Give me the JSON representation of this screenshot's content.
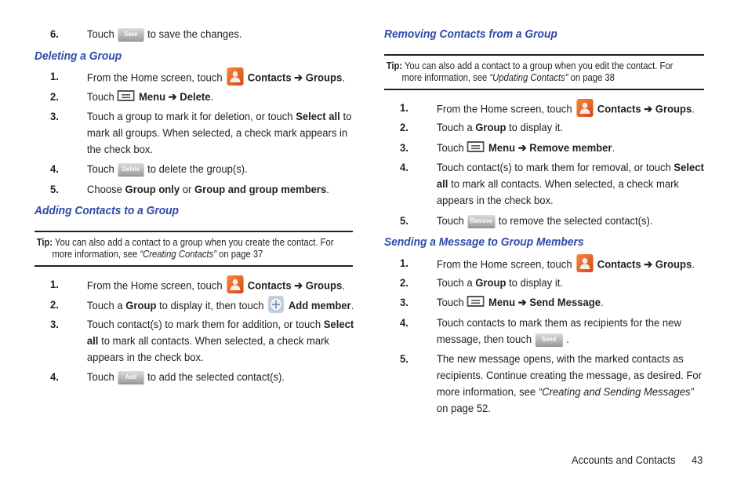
{
  "left": {
    "step6": {
      "num": "6.",
      "pre": "Touch",
      "button": "Save",
      "post": "to save the changes."
    },
    "deleting": {
      "heading": "Deleting a Group",
      "steps": [
        {
          "num": "1.",
          "pre": "From the Home screen, touch",
          "icon": "contacts-icon",
          "bold": "Contacts ➔ Groups",
          "post": "."
        },
        {
          "num": "2.",
          "pre": "Touch",
          "icon": "menu-icon",
          "bold": "Menu ➔ Delete",
          "post": "."
        },
        {
          "num": "3.",
          "l1a": "Touch a group to mark it for deletion, or touch ",
          "l1b": "Select all",
          "l1c": " to",
          "l2": "mark all groups. When selected, a check mark appears in",
          "l3": "the check box."
        },
        {
          "num": "4.",
          "pre": "Touch",
          "button": "Delete",
          "post": "to delete the group(s)."
        },
        {
          "num": "5.",
          "a": "Choose ",
          "b": "Group only",
          "c": " or ",
          "d": "Group and group members",
          "e": "."
        }
      ]
    },
    "adding": {
      "heading": "Adding Contacts to a Group",
      "tip": {
        "label": "Tip:",
        "line1": "You can also add a contact to a group when you create the contact. For",
        "line2a": "more information, see ",
        "line2b": "“Creating Contacts”",
        "line2c": " on page 37"
      },
      "steps": [
        {
          "num": "1.",
          "pre": "From the Home screen, touch",
          "icon": "contacts-icon",
          "bold": "Contacts ➔ Groups",
          "post": "."
        },
        {
          "num": "2.",
          "pre": "Touch a ",
          "b1": "Group",
          "mid": " to display it, then touch",
          "icon": "add-icon",
          "bold": "Add member",
          "post": "."
        },
        {
          "num": "3.",
          "l1a": "Touch contact(s) to mark them for addition, or touch ",
          "l1b": "Select",
          "l2a": "all",
          "l2b": " to mark all contacts. When selected, a check mark",
          "l3": "appears in the check box."
        },
        {
          "num": "4.",
          "pre": "Touch",
          "button": "Add",
          "post": "to add the selected contact(s)."
        }
      ]
    }
  },
  "right": {
    "removing": {
      "heading": "Removing Contacts from a Group",
      "tip": {
        "label": "Tip:",
        "line1": "You can also add a contact to a group when you edit the contact. For",
        "line2a": "more information, see ",
        "line2b": "“Updating Contacts”",
        "line2c": " on page 38"
      },
      "steps": [
        {
          "num": "1.",
          "pre": "From the Home screen, touch",
          "icon": "contacts-icon",
          "bold": "Contacts ➔ Groups",
          "post": "."
        },
        {
          "num": "2.",
          "pre": "Touch a ",
          "b1": "Group",
          "post": " to display it."
        },
        {
          "num": "3.",
          "pre": "Touch",
          "icon": "menu-icon",
          "bold": "Menu ➔ Remove member",
          "post": "."
        },
        {
          "num": "4.",
          "l1a": "Touch contact(s) to mark them for removal, or touch ",
          "l1b": "Select",
          "l2a": "all",
          "l2b": " to mark all contacts. When selected, a check mark",
          "l3": "appears in the check box."
        },
        {
          "num": "5.",
          "pre": "Touch",
          "button": "Remove",
          "post": "to remove the selected contact(s)."
        }
      ]
    },
    "sending": {
      "heading": "Sending a Message to Group Members",
      "steps": [
        {
          "num": "1.",
          "pre": "From the Home screen, touch",
          "icon": "contacts-icon",
          "bold": "Contacts ➔ Groups",
          "post": "."
        },
        {
          "num": "2.",
          "pre": "Touch a ",
          "b1": "Group",
          "post": " to display it."
        },
        {
          "num": "3.",
          "pre": "Touch",
          "icon": "menu-icon",
          "bold": "Menu ➔ Send Message",
          "post": "."
        },
        {
          "num": "4.",
          "l1": "Touch contacts to mark them as recipients for the new",
          "l2": "message, then touch",
          "button": "Send",
          "post": "."
        },
        {
          "num": "5.",
          "l1": "The new message opens, with the marked contacts as",
          "l2": "recipients. Continue creating the message, as desired. For",
          "l3a": "more information, see ",
          "l3b": "“Creating and Sending Messages”",
          "l4": "on page 52."
        }
      ]
    }
  },
  "footer": {
    "section": "Accounts and Contacts",
    "page": "43"
  }
}
